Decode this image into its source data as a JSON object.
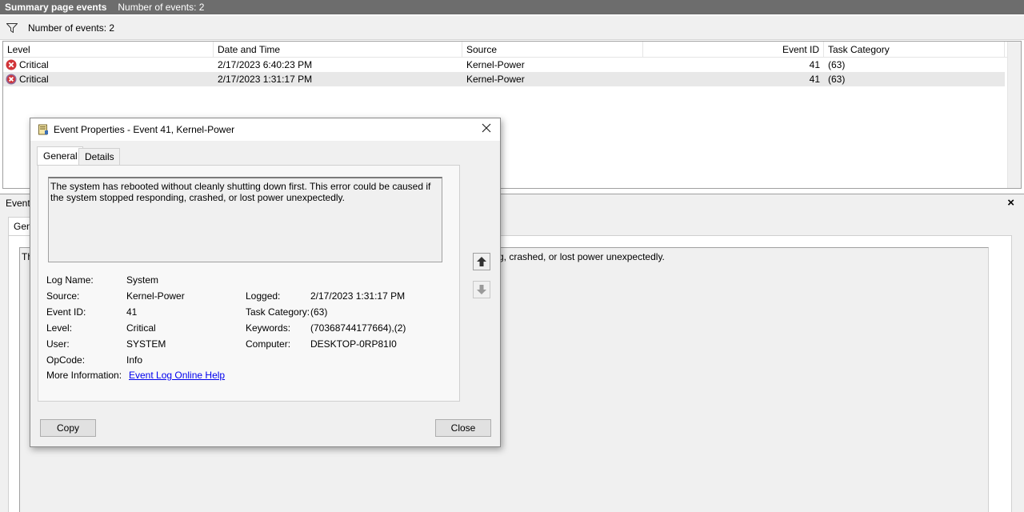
{
  "titlebar": {
    "title": "Summary page events",
    "count": "Number of events: 2"
  },
  "filterbar": {
    "text": "Number of events: 2"
  },
  "list": {
    "columns": [
      "Level",
      "Date and Time",
      "Source",
      "Event ID",
      "Task Category"
    ],
    "rows": [
      {
        "level": "Critical",
        "date": "2/17/2023 6:40:23 PM",
        "source": "Kernel-Power",
        "id": "41",
        "category": "(63)"
      },
      {
        "level": "Critical",
        "date": "2/17/2023 1:31:17 PM",
        "source": "Kernel-Power",
        "id": "41",
        "category": "(63)"
      }
    ]
  },
  "preview": {
    "title": "Event",
    "tab": "Gen",
    "text_start": "Th",
    "text_end": "g, crashed, or lost power unexpectedly.",
    "close": "×"
  },
  "dialog": {
    "title": "Event Properties - Event 41, Kernel-Power",
    "tabs": [
      "General",
      "Details"
    ],
    "message": "The system has rebooted without cleanly shutting down first. This error could be caused if the system stopped responding, crashed, or lost power unexpectedly.",
    "fields": {
      "log_name_label": "Log Name:",
      "log_name": "System",
      "source_label": "Source:",
      "source": "Kernel-Power",
      "logged_label": "Logged:",
      "logged": "2/17/2023 1:31:17 PM",
      "event_id_label": "Event ID:",
      "event_id": "41",
      "task_category_label": "Task Category:",
      "task_category": "(63)",
      "level_label": "Level:",
      "level": "Critical",
      "keywords_label": "Keywords:",
      "keywords": "(70368744177664),(2)",
      "user_label": "User:",
      "user": "SYSTEM",
      "computer_label": "Computer:",
      "computer": "DESKTOP-0RP81I0",
      "opcode_label": "OpCode:",
      "opcode": "Info",
      "more_info_label": "More Information:",
      "more_info_link": "Event Log Online Help"
    },
    "copy_label": "Copy",
    "close_label": "Close"
  }
}
